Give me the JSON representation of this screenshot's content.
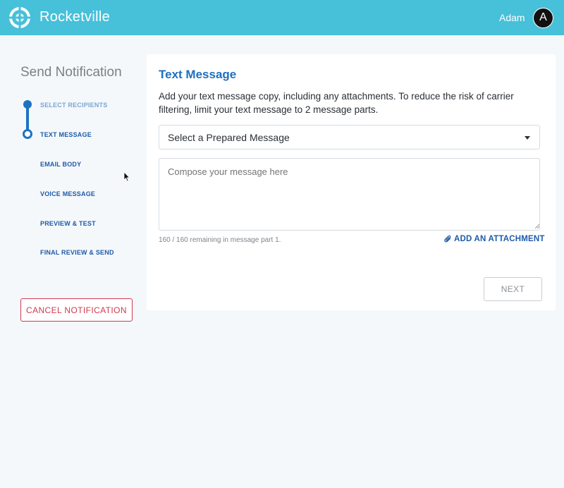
{
  "header": {
    "brand": "Rocketville",
    "user_name": "Adam",
    "avatar_initial": "A",
    "logo_icon": "rocketville-logo-icon",
    "bar_color": "#47c0d9"
  },
  "sidebar": {
    "title": "Send Notification",
    "steps": [
      {
        "label": "SELECT RECIPIENTS",
        "state": "done"
      },
      {
        "label": "TEXT MESSAGE",
        "state": "current"
      },
      {
        "label": "EMAIL BODY",
        "state": "upcoming"
      },
      {
        "label": "VOICE MESSAGE",
        "state": "upcoming"
      },
      {
        "label": "PREVIEW & TEST",
        "state": "upcoming"
      },
      {
        "label": "FINAL REVIEW & SEND",
        "state": "upcoming"
      }
    ],
    "cancel_label": "CANCEL NOTIFICATION"
  },
  "main": {
    "title": "Text Message",
    "description": "Add your text message copy, including any attachments. To reduce the risk of carrier filtering, limit your text message to 2 message parts.",
    "select": {
      "value": "Select a Prepared Message",
      "icon": "caret-down-icon"
    },
    "compose": {
      "placeholder": "Compose your message here",
      "value": ""
    },
    "remaining_text": "160 / 160 remaining in message part 1.",
    "attachment_label": "ADD AN ATTACHMENT",
    "attachment_icon": "paperclip-icon",
    "next_label": "NEXT"
  },
  "colors": {
    "accent": "#1f6fbf",
    "danger": "#d0394f"
  }
}
